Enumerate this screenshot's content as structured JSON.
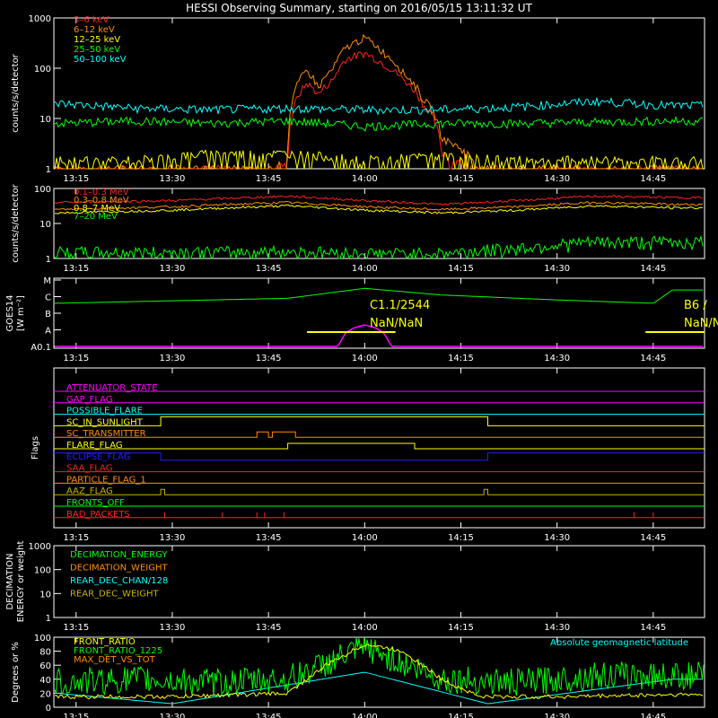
{
  "title": "HESSI Observing Summary, starting on 2016/05/15 13:11:32 UT",
  "time_ticks": [
    "13:15",
    "13:30",
    "13:45",
    "14:00",
    "14:15",
    "14:30",
    "14:45"
  ],
  "colors": {
    "red": "#ff2020",
    "orange": "#ff8c00",
    "yellow": "#ffff00",
    "green": "#00ff00",
    "cyan": "#00ffff",
    "magenta": "#ff00ff",
    "blue": "#2020ff",
    "olive": "#c8b400",
    "lightgreen": "#80ff80",
    "gray": "#888888"
  },
  "chart_data": [
    {
      "type": "line",
      "panel": "count-rates",
      "ylabel": "counts/s/detector",
      "yscale": "log",
      "ylim": [
        1,
        1000
      ],
      "yticks": [
        "1",
        "10",
        "100",
        "1000"
      ],
      "series": [
        {
          "name": "3–6 keV",
          "color": "#ff2020",
          "x": [
            13.2,
            13.75,
            13.8,
            13.85,
            13.88,
            13.92,
            13.95,
            14.0,
            14.05,
            14.1,
            14.15,
            14.2,
            14.3
          ],
          "y": [
            1,
            1,
            1.2,
            50,
            30,
            60,
            150,
            200,
            120,
            60,
            20,
            2,
            1
          ]
        },
        {
          "name": "6–12 keV",
          "color": "#ff8c00",
          "x": [
            13.2,
            13.75,
            13.8,
            13.85,
            13.88,
            13.92,
            13.95,
            14.0,
            14.05,
            14.1,
            14.15,
            14.2,
            14.3
          ],
          "y": [
            1,
            1,
            2,
            90,
            40,
            100,
            250,
            400,
            200,
            80,
            25,
            4,
            1
          ]
        },
        {
          "name": "12–25 keV",
          "color": "#ffff00",
          "x": [
            13.2,
            13.4,
            13.6,
            13.8,
            14.0,
            14.2,
            14.4,
            14.8
          ],
          "y": [
            1.5,
            1.5,
            2,
            2,
            1.5,
            1.8,
            1.5,
            1.5
          ]
        },
        {
          "name": "25–50 keV",
          "color": "#00ff00",
          "x": [
            13.2,
            13.4,
            13.6,
            13.8,
            14.0,
            14.2,
            14.4,
            14.8
          ],
          "y": [
            8,
            9,
            8,
            9,
            7,
            8,
            8,
            9
          ]
        },
        {
          "name": "50–100 keV",
          "color": "#00ffff",
          "x": [
            13.2,
            13.4,
            13.6,
            13.8,
            14.0,
            14.2,
            14.4,
            14.6,
            14.8
          ],
          "y": [
            20,
            16,
            15,
            16,
            15,
            15,
            17,
            22,
            18
          ]
        }
      ]
    },
    {
      "type": "line",
      "panel": "high-energy",
      "ylabel": "counts/s/detector",
      "yscale": "log",
      "ylim": [
        1,
        100
      ],
      "yticks": [
        "1",
        "10",
        "100"
      ],
      "series": [
        {
          "name": "0.1–0.3 MeV",
          "color": "#ff2020",
          "x": [
            13.2,
            13.5,
            13.8,
            14.0,
            14.2,
            14.4,
            14.6,
            14.8
          ],
          "y": [
            40,
            45,
            60,
            45,
            35,
            45,
            60,
            55
          ]
        },
        {
          "name": "0.3–0.8 MeV",
          "color": "#ff8c00",
          "x": [
            13.2,
            13.5,
            13.8,
            14.0,
            14.2,
            14.4,
            14.6,
            14.8
          ],
          "y": [
            25,
            30,
            40,
            30,
            25,
            30,
            40,
            35
          ]
        },
        {
          "name": "0.8–7 MeV",
          "color": "#ffff00",
          "x": [
            13.2,
            13.5,
            13.8,
            14.0,
            14.2,
            14.4,
            14.6,
            14.8
          ],
          "y": [
            20,
            24,
            32,
            24,
            20,
            24,
            32,
            28
          ]
        },
        {
          "name": "7–20 MeV",
          "color": "#00ff00",
          "x": [
            13.2,
            13.5,
            13.8,
            14.0,
            14.2,
            14.4,
            14.6,
            14.8
          ],
          "y": [
            1.5,
            1.5,
            1.6,
            1.4,
            1.4,
            2,
            3,
            3
          ]
        }
      ]
    },
    {
      "type": "line",
      "panel": "goes",
      "ylabel": "GOES14",
      "yunit": "[W m⁻²]",
      "ylevels": [
        "A0.1",
        "A",
        "B",
        "C",
        "M"
      ],
      "annotations": [
        "C1.1/2544",
        "NaN/NaN",
        "B6 /",
        "NaN/N"
      ],
      "series": [
        {
          "name": "GOES low",
          "color": "#00ff00",
          "x": [
            13.2,
            13.6,
            13.8,
            14.0,
            14.2,
            14.5,
            14.75,
            14.8
          ],
          "y": [
            2.6,
            2.8,
            2.9,
            3.5,
            3.1,
            2.8,
            2.6,
            3.4
          ]
        },
        {
          "name": "GOES high",
          "color": "#ff00ff",
          "x": [
            13.2,
            13.93,
            13.95,
            13.97,
            14.0,
            14.03,
            14.05,
            14.07,
            14.8
          ],
          "y": [
            0,
            0,
            0.8,
            1.1,
            1.3,
            1.1,
            0.8,
            0,
            0
          ]
        }
      ]
    },
    {
      "type": "flags",
      "panel": "flags",
      "ylabel": "Flags",
      "flags": [
        {
          "name": "ATTENUATOR_STATE",
          "color": "#ff00ff"
        },
        {
          "name": "GAP_FLAG",
          "color": "#ff00ff"
        },
        {
          "name": "POSSIBLE_FLARE",
          "color": "#00ffff"
        },
        {
          "name": "SC_IN_SUNLIGHT",
          "color": "#ffff00"
        },
        {
          "name": "SC_TRANSMITTER",
          "color": "#ff8c00"
        },
        {
          "name": "FLARE_FLAG",
          "color": "#ffff00"
        },
        {
          "name": "ECLIPSE_FLAG",
          "color": "#2020ff"
        },
        {
          "name": "SAA_FLAG",
          "color": "#ff2020"
        },
        {
          "name": "PARTICLE_FLAG_1",
          "color": "#ff8c00"
        },
        {
          "name": "AAZ_FLAG",
          "color": "#c8b400"
        },
        {
          "name": "FRONTS_OFF",
          "color": "#00ff00"
        },
        {
          "name": "BAD_PACKETS",
          "color": "#ff2020"
        }
      ]
    },
    {
      "type": "line",
      "panel": "decimation",
      "ylabel": "DECIMATION ENERGY or weight",
      "yscale": "log",
      "ylim": [
        1,
        1000
      ],
      "yticks": [
        "1",
        "10",
        "100",
        "1000"
      ],
      "series": [
        {
          "name": "DECIMATION_ENERGY",
          "color": "#00ff00",
          "x": [],
          "y": []
        },
        {
          "name": "DECIMATION_WEIGHT",
          "color": "#ff8c00",
          "x": [],
          "y": []
        },
        {
          "name": "REAR_DEC_CHAN/128",
          "color": "#00ffff",
          "x": [],
          "y": []
        },
        {
          "name": "REAR_DEC_WEIGHT",
          "color": "#c8b400",
          "x": [],
          "y": []
        }
      ]
    },
    {
      "type": "line",
      "panel": "ratios",
      "ylabel": "Degrees or %",
      "ylim": [
        0,
        100
      ],
      "yticks": [
        "0",
        "20",
        "40",
        "60",
        "80",
        "100"
      ],
      "annotation": "Absolute geomagnetic latitude",
      "series": [
        {
          "name": "FRONT_RATIO",
          "color": "#ffff00",
          "x": [
            13.2,
            13.5,
            13.8,
            13.9,
            14.0,
            14.1,
            14.2,
            14.3,
            14.5,
            14.8
          ],
          "y": [
            15,
            15,
            20,
            60,
            90,
            80,
            40,
            15,
            15,
            18
          ]
        },
        {
          "name": "FRONT_RATIO_1225",
          "color": "#00ff00",
          "x": [
            13.2,
            13.4,
            13.6,
            13.8,
            14.0,
            14.2,
            14.4,
            14.6,
            14.8
          ],
          "y": [
            35,
            40,
            35,
            40,
            85,
            40,
            35,
            45,
            45
          ]
        },
        {
          "name": "MAX_DET_VS_TOT",
          "color": "#ff8c00",
          "x": [],
          "y": []
        },
        {
          "name": "Absolute geomagnetic latitude",
          "color": "#00ffff",
          "x": [
            13.2,
            13.5,
            14.0,
            14.32,
            14.8
          ],
          "y": [
            20,
            5,
            50,
            5,
            40
          ]
        }
      ]
    }
  ]
}
